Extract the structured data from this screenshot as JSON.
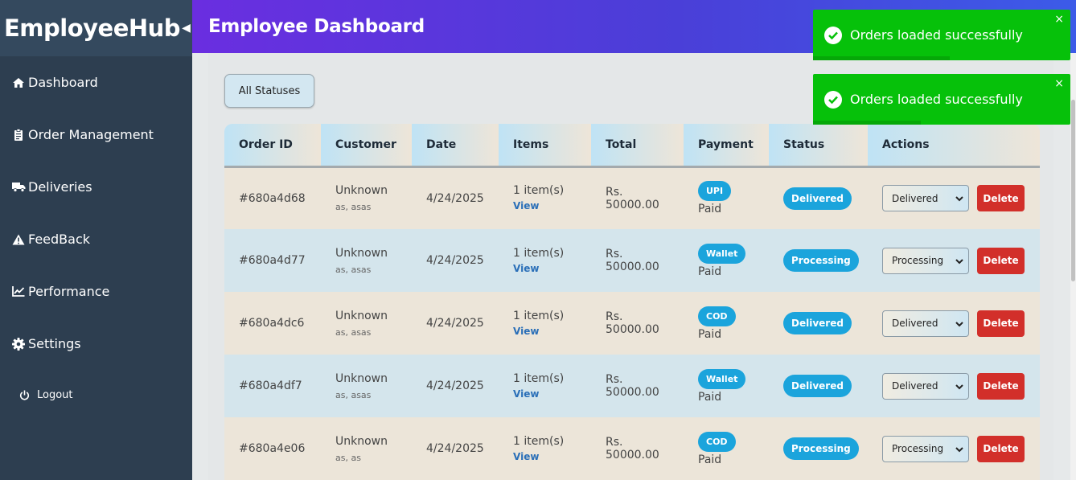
{
  "brand": {
    "title": "EmployeeHub",
    "toggle": "◀"
  },
  "header": {
    "title": "Employee Dashboard"
  },
  "sidebar": {
    "items": [
      {
        "label": "Dashboard",
        "icon": "home-icon"
      },
      {
        "label": "Order Management",
        "icon": "clipboard-icon"
      },
      {
        "label": "Deliveries",
        "icon": "truck-icon"
      },
      {
        "label": "FeedBack",
        "icon": "warning-icon"
      },
      {
        "label": "Performance",
        "icon": "chart-line-icon"
      },
      {
        "label": "Settings",
        "icon": "gear-icon"
      }
    ],
    "logout": "Logout"
  },
  "filter": {
    "label": "All Statuses"
  },
  "table": {
    "headers": [
      "Order ID",
      "Customer",
      "Date",
      "Items",
      "Total",
      "Payment",
      "Status",
      "Actions"
    ],
    "rows": [
      {
        "id": "#680a4d68",
        "customer": "Unknown",
        "address": "as, asas",
        "date": "4/24/2025",
        "items": "1 item(s)",
        "view": "View",
        "total_cur": "Rs.",
        "total_amt": "50000.00",
        "pay_method": "UPI",
        "pay_status": "Paid",
        "status": "Delivered",
        "select": "Delivered",
        "delete": "Delete"
      },
      {
        "id": "#680a4d77",
        "customer": "Unknown",
        "address": "as, asas",
        "date": "4/24/2025",
        "items": "1 item(s)",
        "view": "View",
        "total_cur": "Rs.",
        "total_amt": "50000.00",
        "pay_method": "Wallet",
        "pay_status": "Paid",
        "status": "Processing",
        "select": "Processing",
        "delete": "Delete"
      },
      {
        "id": "#680a4dc6",
        "customer": "Unknown",
        "address": "as, asas",
        "date": "4/24/2025",
        "items": "1 item(s)",
        "view": "View",
        "total_cur": "Rs.",
        "total_amt": "50000.00",
        "pay_method": "COD",
        "pay_status": "Paid",
        "status": "Delivered",
        "select": "Delivered",
        "delete": "Delete"
      },
      {
        "id": "#680a4df7",
        "customer": "Unknown",
        "address": "as, asas",
        "date": "4/24/2025",
        "items": "1 item(s)",
        "view": "View",
        "total_cur": "Rs.",
        "total_amt": "50000.00",
        "pay_method": "Wallet",
        "pay_status": "Paid",
        "status": "Delivered",
        "select": "Delivered",
        "delete": "Delete"
      },
      {
        "id": "#680a4e06",
        "customer": "Unknown",
        "address": "as, as",
        "date": "4/24/2025",
        "items": "1 item(s)",
        "view": "View",
        "total_cur": "Rs.",
        "total_amt": "50000.00",
        "pay_method": "COD",
        "pay_status": "Paid",
        "status": "Processing",
        "select": "Processing",
        "delete": "Delete"
      }
    ]
  },
  "toasts": [
    {
      "message": "Orders loaded successfully",
      "close": "×",
      "progress": 0.53
    },
    {
      "message": "Orders loaded successfully",
      "close": "×",
      "progress": 0.42
    }
  ],
  "colors": {
    "sidebar": "#2d3e50",
    "header_start": "#6a2ee0",
    "header_end": "#3c5be8",
    "badge": "#1ba4dc",
    "delete": "#d22f2a",
    "toast": "#06c10a"
  }
}
